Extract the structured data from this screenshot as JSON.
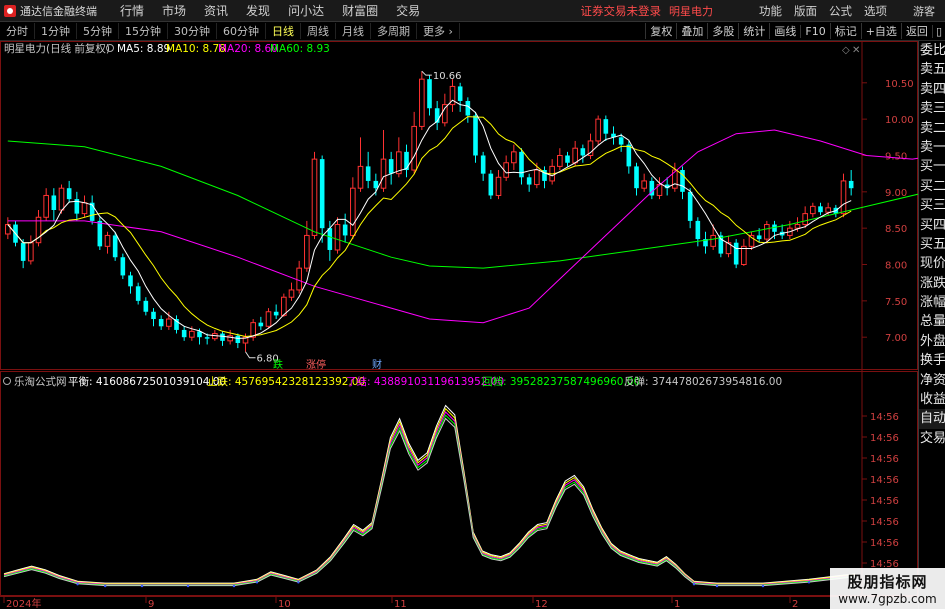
{
  "app": {
    "name": "通达信金融终端",
    "menus": [
      "行情",
      "市场",
      "资讯",
      "发现",
      "问小达",
      "财富圈",
      "交易"
    ],
    "warning": "证券交易未登录",
    "stock_name": "明星电力",
    "right_menus": [
      "功能",
      "版面",
      "公式",
      "选项"
    ],
    "guest": "游客"
  },
  "periods": [
    "分时",
    "1分钟",
    "5分钟",
    "15分钟",
    "30分钟",
    "60分钟",
    "日线",
    "周线",
    "月线",
    "多周期",
    "更多"
  ],
  "active_period": "日线",
  "tools": [
    "复权",
    "叠加",
    "多股",
    "统计",
    "画线",
    "F10",
    "标记",
    "+自选",
    "返回"
  ],
  "price_panel": {
    "title": "明星电力(日线 前复权)",
    "ma5": "MA5: 8.89",
    "ma10": "MA10: 8.78",
    "ma20": "MA20: 8.60",
    "ma60": "MA60: 8.93",
    "high_label": "10.66",
    "low_label": "6.80",
    "signals": [
      "跌",
      "涨停",
      "财"
    ],
    "y_ticks": [
      "10.50",
      "10.00",
      "9.50",
      "9.00",
      "8.50",
      "8.00",
      "7.50",
      "7.00"
    ],
    "colors": {
      "up": "#ff3232",
      "down": "#00ffff",
      "ma5": "#ffffff",
      "ma10": "#ffff00",
      "ma20": "#ff00ff",
      "ma60": "#00ff00"
    }
  },
  "indicator_panel": {
    "name": "乐淘公式网",
    "ping_heng": "平衡: 41608672501039104.00",
    "zhi_die": "止跌: 45769542328123392.00",
    "liao_jie": "了结: 43889103119613952.00",
    "hui_dang": "回档: 39528237587496960.00",
    "fan_tan": "反弹: 37447802673954816.00",
    "y_ticks": [
      "14:56",
      "14:56",
      "14:56",
      "14:56",
      "14:56",
      "14:56",
      "14:56",
      "14:56"
    ]
  },
  "x_axis": [
    "2024年",
    "9",
    "10",
    "11",
    "12",
    "1",
    "2"
  ],
  "side_panel": [
    "委比",
    "卖五",
    "卖四",
    "卖三",
    "卖二",
    "卖一",
    "买一",
    "买二",
    "买三",
    "买四",
    "买五",
    "现价",
    "涨跌",
    "涨幅",
    "总量",
    "外盘",
    "换手",
    "净资",
    "收益",
    "自动",
    "交易"
  ],
  "watermark": {
    "line1": "股朋指标网",
    "line2": "www.7gpzb.com"
  },
  "chart_data": {
    "type": "candlestick",
    "y_range": [
      6.7,
      10.8
    ],
    "highest": 10.66,
    "lowest": 6.8,
    "candles": [
      [
        8.42,
        8.55,
        8.65,
        8.35
      ],
      [
        8.55,
        8.3,
        8.6,
        8.25
      ],
      [
        8.3,
        8.05,
        8.35,
        7.95
      ],
      [
        8.05,
        8.3,
        8.4,
        8.0
      ],
      [
        8.3,
        8.65,
        8.75,
        8.25
      ],
      [
        8.65,
        8.95,
        9.05,
        8.6
      ],
      [
        8.95,
        8.75,
        9.05,
        8.6
      ],
      [
        8.75,
        9.05,
        9.1,
        8.7
      ],
      [
        9.05,
        8.9,
        9.15,
        8.85
      ],
      [
        8.9,
        8.7,
        9.0,
        8.6
      ],
      [
        8.7,
        8.85,
        8.95,
        8.65
      ],
      [
        8.85,
        8.6,
        8.95,
        8.55
      ],
      [
        8.6,
        8.25,
        8.65,
        8.2
      ],
      [
        8.25,
        8.4,
        8.45,
        8.15
      ],
      [
        8.4,
        8.1,
        8.45,
        8.05
      ],
      [
        8.1,
        7.85,
        8.15,
        7.8
      ],
      [
        7.85,
        7.7,
        7.9,
        7.6
      ],
      [
        7.7,
        7.5,
        7.75,
        7.45
      ],
      [
        7.5,
        7.35,
        7.55,
        7.3
      ],
      [
        7.35,
        7.25,
        7.4,
        7.15
      ],
      [
        7.25,
        7.15,
        7.3,
        7.1
      ],
      [
        7.15,
        7.25,
        7.35,
        7.1
      ],
      [
        7.25,
        7.1,
        7.3,
        7.05
      ],
      [
        7.1,
        7.0,
        7.15,
        6.95
      ],
      [
        7.0,
        7.08,
        7.15,
        6.95
      ],
      [
        7.08,
        7.0,
        7.12,
        6.9
      ],
      [
        7.0,
        6.98,
        7.05,
        6.9
      ],
      [
        6.98,
        7.05,
        7.1,
        6.95
      ],
      [
        7.05,
        6.95,
        7.08,
        6.88
      ],
      [
        6.95,
        7.02,
        7.1,
        6.9
      ],
      [
        7.02,
        6.92,
        7.05,
        6.85
      ],
      [
        6.92,
        7.0,
        7.05,
        6.8
      ],
      [
        7.0,
        7.2,
        7.25,
        6.95
      ],
      [
        7.2,
        7.15,
        7.28,
        7.1
      ],
      [
        7.15,
        7.35,
        7.4,
        7.12
      ],
      [
        7.35,
        7.3,
        7.45,
        7.25
      ],
      [
        7.3,
        7.55,
        7.6,
        7.28
      ],
      [
        7.55,
        7.65,
        7.75,
        7.5
      ],
      [
        7.65,
        7.95,
        8.05,
        7.6
      ],
      [
        7.95,
        8.4,
        8.6,
        7.9
      ],
      [
        8.4,
        9.45,
        9.55,
        8.35
      ],
      [
        9.45,
        8.5,
        9.5,
        8.3
      ],
      [
        8.5,
        8.2,
        8.6,
        8.05
      ],
      [
        8.2,
        8.55,
        8.65,
        8.15
      ],
      [
        8.55,
        8.4,
        8.7,
        8.3
      ],
      [
        8.4,
        9.05,
        9.2,
        8.35
      ],
      [
        9.05,
        9.35,
        9.75,
        9.0
      ],
      [
        9.35,
        9.15,
        9.55,
        9.05
      ],
      [
        9.15,
        9.05,
        9.25,
        8.95
      ],
      [
        9.05,
        9.45,
        9.85,
        9.0
      ],
      [
        9.45,
        9.25,
        9.55,
        9.1
      ],
      [
        9.25,
        9.55,
        9.75,
        9.2
      ],
      [
        9.55,
        9.3,
        9.65,
        9.2
      ],
      [
        9.3,
        9.9,
        10.1,
        9.25
      ],
      [
        9.9,
        10.55,
        10.66,
        9.85
      ],
      [
        10.55,
        10.15,
        10.6,
        10.05
      ],
      [
        10.15,
        9.95,
        10.25,
        9.85
      ],
      [
        9.95,
        10.2,
        10.35,
        9.9
      ],
      [
        10.2,
        10.45,
        10.55,
        10.1
      ],
      [
        10.45,
        10.25,
        10.5,
        10.1
      ],
      [
        10.25,
        10.05,
        10.3,
        9.95
      ],
      [
        10.05,
        9.5,
        10.1,
        9.4
      ],
      [
        9.5,
        9.25,
        9.55,
        9.15
      ],
      [
        9.25,
        8.95,
        9.3,
        8.9
      ],
      [
        8.95,
        9.2,
        9.3,
        8.9
      ],
      [
        9.2,
        9.4,
        9.5,
        9.15
      ],
      [
        9.4,
        9.55,
        9.65,
        9.3
      ],
      [
        9.55,
        9.2,
        9.6,
        9.1
      ],
      [
        9.2,
        9.1,
        9.25,
        9.0
      ],
      [
        9.1,
        9.3,
        9.4,
        9.05
      ],
      [
        9.3,
        9.15,
        9.35,
        9.05
      ],
      [
        9.15,
        9.35,
        9.45,
        9.1
      ],
      [
        9.35,
        9.5,
        9.6,
        9.3
      ],
      [
        9.5,
        9.4,
        9.55,
        9.35
      ],
      [
        9.4,
        9.6,
        9.7,
        9.35
      ],
      [
        9.6,
        9.5,
        9.65,
        9.4
      ],
      [
        9.5,
        9.7,
        9.8,
        9.45
      ],
      [
        9.7,
        10.0,
        10.05,
        9.65
      ],
      [
        10.0,
        9.8,
        10.05,
        9.7
      ],
      [
        9.8,
        9.75,
        9.9,
        9.65
      ],
      [
        9.75,
        9.65,
        9.8,
        9.55
      ],
      [
        9.65,
        9.35,
        9.7,
        9.25
      ],
      [
        9.35,
        9.05,
        9.4,
        8.95
      ],
      [
        9.05,
        9.15,
        9.25,
        9.0
      ],
      [
        9.15,
        8.95,
        9.2,
        8.9
      ],
      [
        8.95,
        9.1,
        9.2,
        8.9
      ],
      [
        9.1,
        9.05,
        9.2,
        8.95
      ],
      [
        9.05,
        9.3,
        9.4,
        9.0
      ],
      [
        9.3,
        9.0,
        9.35,
        8.9
      ],
      [
        9.0,
        8.6,
        9.05,
        8.5
      ],
      [
        8.6,
        8.35,
        8.65,
        8.25
      ],
      [
        8.35,
        8.25,
        8.45,
        8.15
      ],
      [
        8.25,
        8.4,
        8.55,
        8.2
      ],
      [
        8.4,
        8.15,
        8.45,
        8.1
      ],
      [
        8.15,
        8.3,
        8.4,
        8.1
      ],
      [
        8.3,
        8.0,
        8.35,
        7.95
      ],
      [
        8.0,
        8.25,
        8.35,
        7.98
      ],
      [
        8.25,
        8.4,
        8.45,
        8.2
      ],
      [
        8.4,
        8.35,
        8.5,
        8.3
      ],
      [
        8.35,
        8.55,
        8.6,
        8.3
      ],
      [
        8.55,
        8.45,
        8.6,
        8.35
      ],
      [
        8.45,
        8.4,
        8.55,
        8.35
      ],
      [
        8.4,
        8.5,
        8.6,
        8.35
      ],
      [
        8.5,
        8.55,
        8.65,
        8.45
      ],
      [
        8.55,
        8.7,
        8.8,
        8.5
      ],
      [
        8.7,
        8.8,
        8.85,
        8.65
      ],
      [
        8.8,
        8.72,
        8.85,
        8.68
      ],
      [
        8.72,
        8.78,
        8.85,
        8.68
      ],
      [
        8.78,
        8.7,
        8.82,
        8.65
      ],
      [
        8.7,
        9.15,
        9.25,
        8.65
      ],
      [
        9.15,
        9.05,
        9.3,
        8.95
      ]
    ],
    "ma60": [
      [
        0,
        9.7
      ],
      [
        10,
        9.62
      ],
      [
        20,
        9.35
      ],
      [
        30,
        8.95
      ],
      [
        40,
        8.45
      ],
      [
        50,
        8.1
      ],
      [
        55,
        7.98
      ],
      [
        62,
        7.95
      ],
      [
        72,
        8.05
      ],
      [
        82,
        8.2
      ],
      [
        92,
        8.35
      ],
      [
        102,
        8.55
      ],
      [
        112,
        8.8
      ],
      [
        122,
        9.05
      ],
      [
        130,
        9.25
      ],
      [
        138,
        9.4
      ],
      [
        150,
        9.4
      ],
      [
        160,
        9.3
      ],
      [
        170,
        9.15
      ],
      [
        178,
        9.0
      ],
      [
        185,
        8.92
      ]
    ],
    "ma20": [
      [
        0,
        8.6
      ],
      [
        10,
        8.6
      ],
      [
        20,
        8.45
      ],
      [
        30,
        8.1
      ],
      [
        40,
        7.7
      ],
      [
        50,
        7.4
      ],
      [
        55,
        7.25
      ],
      [
        62,
        7.2
      ],
      [
        68,
        7.4
      ],
      [
        72,
        7.8
      ],
      [
        78,
        8.4
      ],
      [
        84,
        9.0
      ],
      [
        90,
        9.55
      ],
      [
        95,
        9.8
      ],
      [
        100,
        9.85
      ],
      [
        106,
        9.7
      ],
      [
        112,
        9.5
      ],
      [
        118,
        9.45
      ],
      [
        124,
        9.55
      ],
      [
        130,
        9.65
      ],
      [
        136,
        9.35
      ],
      [
        142,
        9.05
      ],
      [
        148,
        8.65
      ],
      [
        154,
        8.35
      ],
      [
        160,
        8.25
      ],
      [
        166,
        8.3
      ],
      [
        172,
        8.4
      ],
      [
        178,
        8.48
      ],
      [
        185,
        8.6
      ]
    ],
    "indicator": {
      "y_range": [
        0,
        100
      ],
      "points": [
        [
          0,
          6
        ],
        [
          3,
          8
        ],
        [
          6,
          10
        ],
        [
          9,
          8
        ],
        [
          12,
          5
        ],
        [
          16,
          2
        ],
        [
          22,
          1
        ],
        [
          30,
          1
        ],
        [
          40,
          1
        ],
        [
          50,
          1
        ],
        [
          55,
          3
        ],
        [
          58,
          7
        ],
        [
          61,
          5
        ],
        [
          64,
          3
        ],
        [
          68,
          8
        ],
        [
          71,
          15
        ],
        [
          74,
          25
        ],
        [
          76,
          32
        ],
        [
          78,
          29
        ],
        [
          80,
          33
        ],
        [
          82,
          55
        ],
        [
          84,
          78
        ],
        [
          86,
          88
        ],
        [
          88,
          75
        ],
        [
          90,
          66
        ],
        [
          92,
          70
        ],
        [
          94,
          84
        ],
        [
          96,
          95
        ],
        [
          98,
          90
        ],
        [
          100,
          60
        ],
        [
          102,
          28
        ],
        [
          104,
          18
        ],
        [
          106,
          16
        ],
        [
          108,
          15
        ],
        [
          110,
          17
        ],
        [
          112,
          22
        ],
        [
          114,
          28
        ],
        [
          116,
          32
        ],
        [
          118,
          33
        ],
        [
          120,
          45
        ],
        [
          122,
          55
        ],
        [
          124,
          58
        ],
        [
          126,
          52
        ],
        [
          128,
          40
        ],
        [
          130,
          30
        ],
        [
          132,
          22
        ],
        [
          134,
          18
        ],
        [
          136,
          16
        ],
        [
          138,
          14
        ],
        [
          140,
          13
        ],
        [
          142,
          12
        ],
        [
          144,
          15
        ],
        [
          146,
          11
        ],
        [
          148,
          6
        ],
        [
          150,
          2
        ],
        [
          155,
          1
        ],
        [
          165,
          1
        ],
        [
          175,
          3
        ],
        [
          185,
          6
        ]
      ]
    }
  }
}
